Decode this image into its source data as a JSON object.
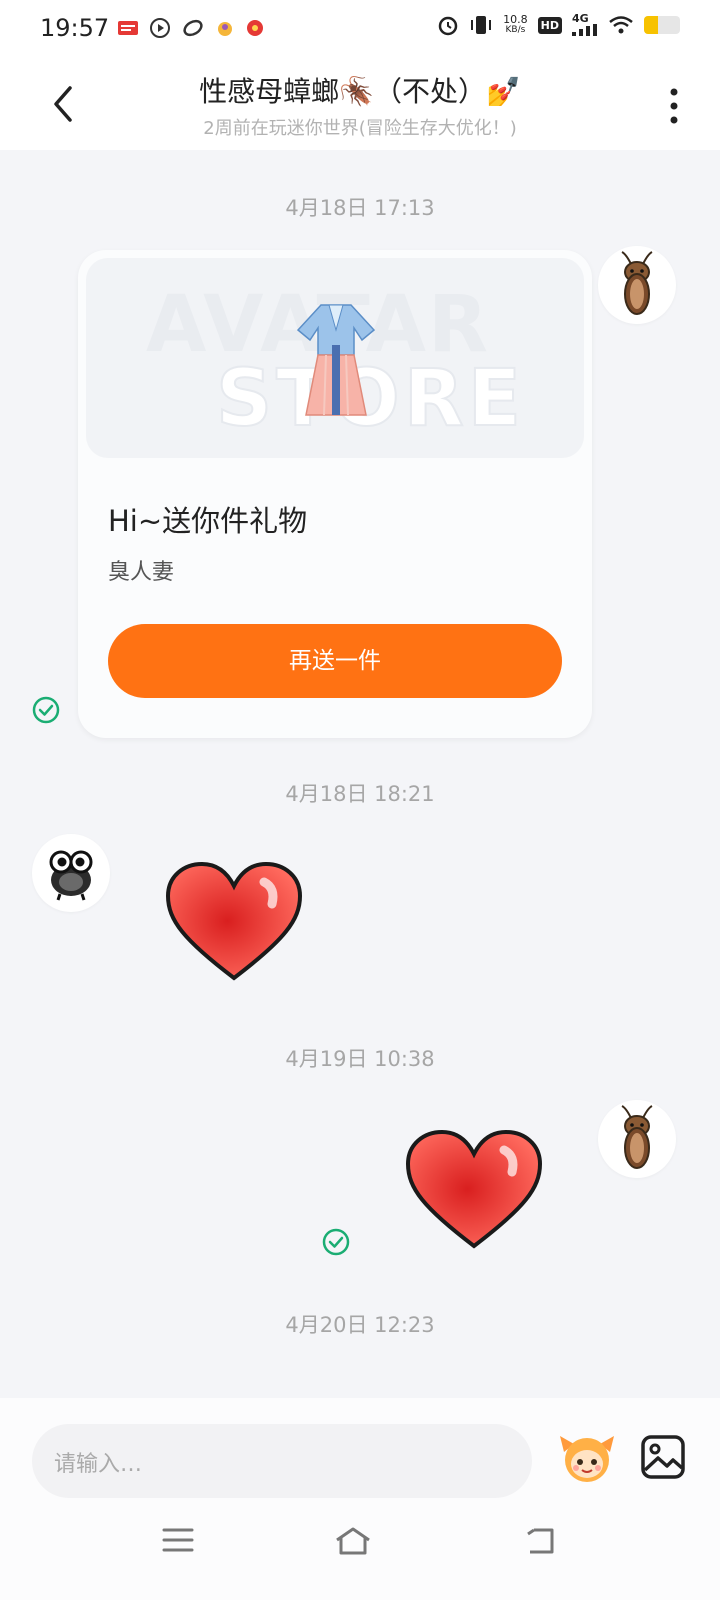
{
  "status": {
    "time": "19:57",
    "speed_value": "10.8",
    "speed_unit": "KB/s",
    "hd": "HD",
    "network": "4G",
    "battery_level": 0.38
  },
  "header": {
    "title": "性感母蟑螂🪳（不处）💅",
    "subtitle": "2周前在玩迷你世界(冒险生存大优化！)"
  },
  "messages": {
    "ts1": "4月18日 17:13",
    "gift_card": {
      "watermark_top": "AVATAR",
      "watermark_bottom": "STORE",
      "title": "Hi~送你件礼物",
      "description": "臭人妻",
      "button": "再送一件"
    },
    "ts2": "4月18日 18:21",
    "ts3": "4月19日 10:38",
    "ts4": "4月20日 12:23"
  },
  "input": {
    "placeholder": "请输入…"
  },
  "colors": {
    "accent": "#ff7213",
    "check": "#1aad73",
    "heart": "#e8413a"
  }
}
